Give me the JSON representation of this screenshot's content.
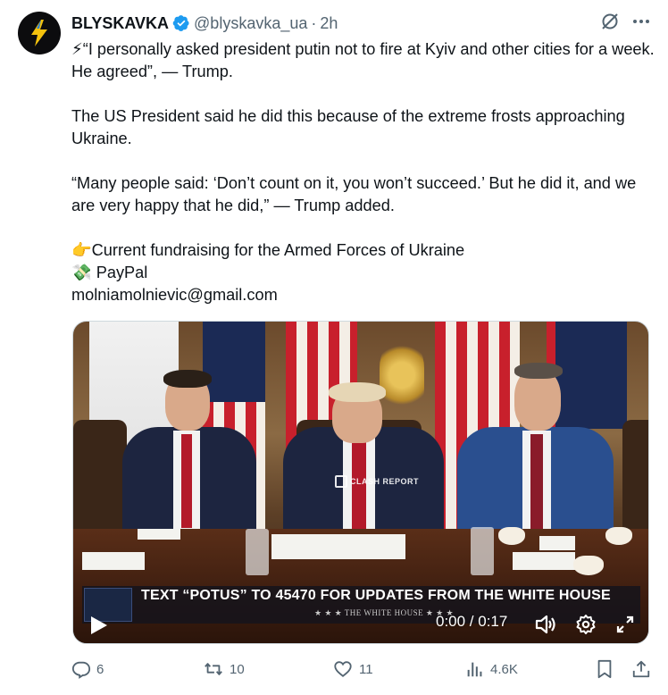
{
  "author": {
    "display_name": "BLYSKAVKA",
    "handle": "@blyskavka_ua",
    "separator": "·",
    "time": "2h"
  },
  "tweet": {
    "p1": "⚡“I personally asked president putin not to fire at Kyiv and other cities for a week. He agreed”, — Trump.",
    "p2": "The US President said he did this because of the extreme frosts approaching Ukraine.",
    "p3": "“Many people said: ‘Don’t count on it, you won’t succeed.’ But he did it, and we are very happy that he did,” — Trump added.",
    "p4": "👉Current fundraising for the Armed Forces of Ukraine",
    "p5": "💸 PayPal",
    "p6": "molniamolnievic@gmail.com"
  },
  "video": {
    "banner_text": "TEXT “POTUS” TO 45470 FOR UPDATES FROM THE WHITE HOUSE",
    "banner_sub": "★ ★ ★   THE WHITE HOUSE   ★ ★ ★",
    "watermark": "CLASH REPORT",
    "time_display": "0:00 / 0:17"
  },
  "actions": {
    "replies": "6",
    "reposts": "10",
    "likes": "11",
    "views": "4.6K"
  },
  "colors": {
    "text": "#0f1419",
    "muted": "#536471",
    "verified": "#1d9bf0",
    "avatar_bolt": "#f4c20d"
  },
  "icons": [
    "verified-badge-icon",
    "grok-icon",
    "more-icon",
    "play-icon",
    "volume-icon",
    "settings-icon",
    "fullscreen-icon",
    "reply-icon",
    "repost-icon",
    "like-icon",
    "views-icon",
    "bookmark-icon",
    "share-icon"
  ]
}
